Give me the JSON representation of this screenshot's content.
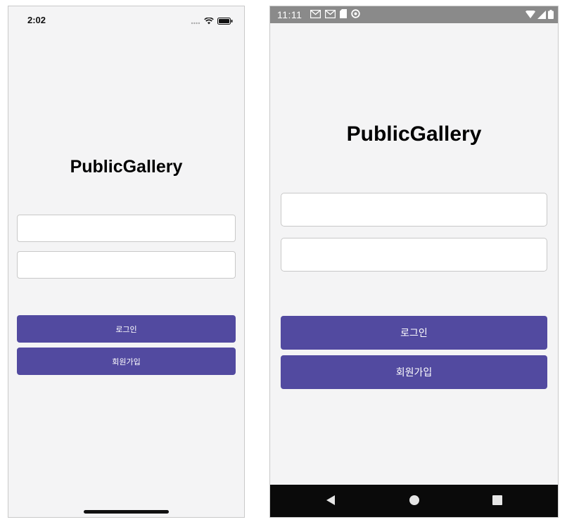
{
  "ios": {
    "status_time": "2:02",
    "title": "PublicGallery",
    "email_value": "",
    "password_value": "",
    "login_label": "로그인",
    "signup_label": "회원가입"
  },
  "android": {
    "status_time": "11:11",
    "title": "PublicGallery",
    "email_value": "",
    "password_value": "",
    "login_label": "로그인",
    "signup_label": "회원가입"
  },
  "colors": {
    "primary": "#524aa0",
    "background": "#f4f4f5",
    "android_status_bar": "#8a8a8a",
    "android_nav_bar": "#0a0a0a"
  },
  "icons": {
    "ios_status": [
      "cellular-dots-icon",
      "wifi-icon",
      "battery-icon"
    ],
    "android_status_left": [
      "gmail-icon",
      "gmail-icon",
      "sd-card-icon",
      "sync-icon"
    ],
    "android_status_right": [
      "wifi-icon",
      "signal-icon",
      "battery-icon"
    ],
    "android_nav": [
      "back-icon",
      "home-icon",
      "recents-icon"
    ]
  }
}
